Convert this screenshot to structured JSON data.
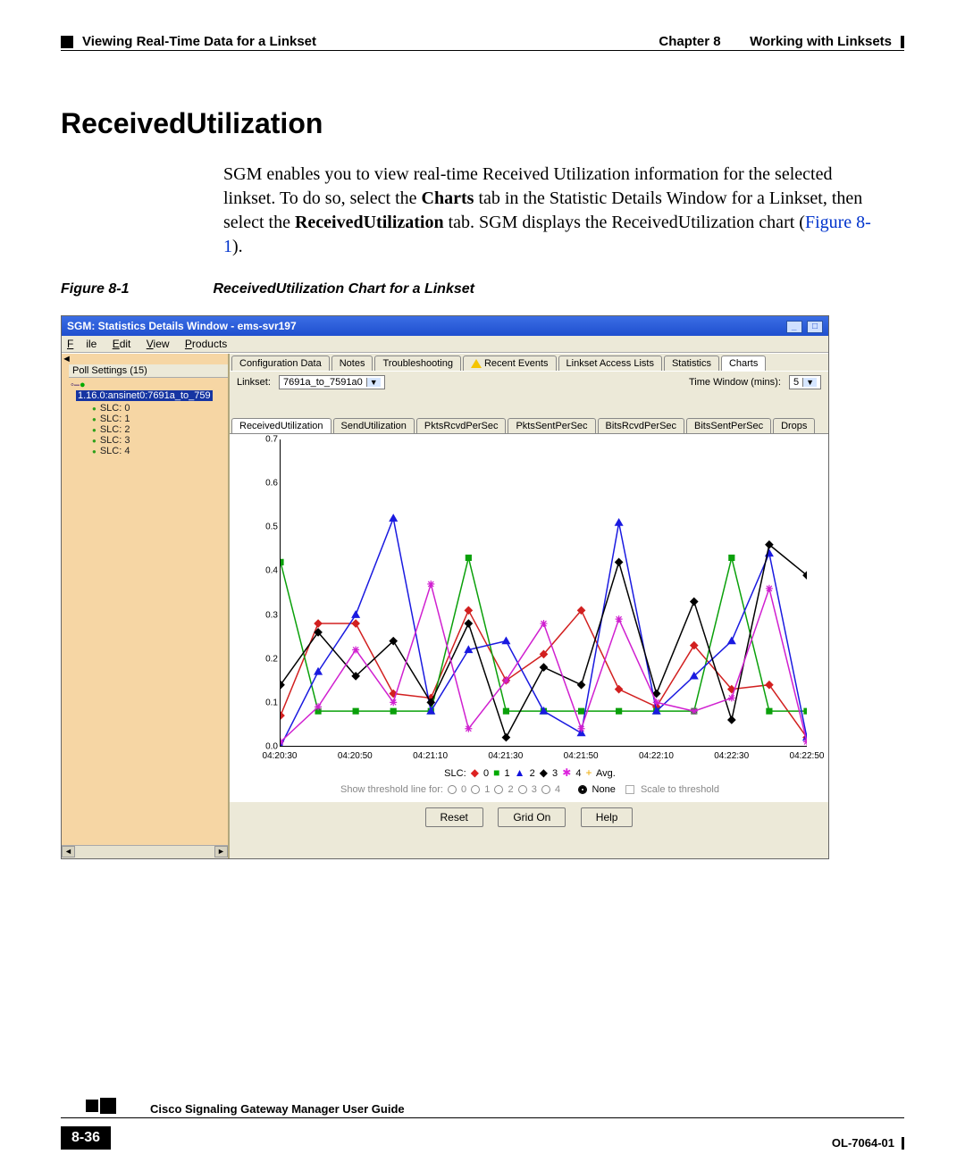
{
  "header": {
    "left": "Viewing Real-Time Data for a Linkset",
    "right_chapter": "Chapter 8",
    "right_title": "Working with Linksets"
  },
  "section_title": "ReceivedUtilization",
  "body": {
    "p1a": "SGM enables you to view real-time Received Utilization information for the selected linkset. To do so, select the ",
    "p1b": "Charts",
    "p1c": " tab in the Statistic Details Window for a Linkset, then select the ",
    "p1d": "ReceivedUtilization",
    "p1e": " tab. SGM displays the ReceivedUtilization chart (",
    "p1f": "Figure 8-1",
    "p1g": ")."
  },
  "figcap": {
    "num": "Figure 8-1",
    "txt": "ReceivedUtilization Chart for a Linkset"
  },
  "window": {
    "title": "SGM: Statistics Details Window - ems-svr197",
    "menu": {
      "file": "File",
      "edit": "Edit",
      "view": "View",
      "products": "Products"
    },
    "sidebar_head": "Poll Settings (15)",
    "sidebar_node": "1.16.0:ansinet0:7691a_to_759",
    "sidebar_items": [
      "SLC: 0",
      "SLC: 1",
      "SLC: 2",
      "SLC: 3",
      "SLC: 4"
    ],
    "tabs1": [
      "Configuration Data",
      "Notes",
      "Troubleshooting",
      "Recent Events",
      "Linkset Access Lists",
      "Statistics",
      "Charts"
    ],
    "tabs2": [
      "ReceivedUtilization",
      "SendUtilization",
      "PktsRcvdPerSec",
      "PktsSentPerSec",
      "BitsRcvdPerSec",
      "BitsSentPerSec",
      "Drops"
    ],
    "linkset_label": "Linkset:",
    "linkset_value": "7691a_to_7591a0",
    "timewin_label": "Time Window (mins):",
    "timewin_value": "5",
    "legend_label": "SLC:",
    "legend_items": [
      {
        "sym": "◆",
        "color": "#d22",
        "label": "0"
      },
      {
        "sym": "■",
        "color": "#0a0",
        "label": "1"
      },
      {
        "sym": "▲",
        "color": "#11d",
        "label": "2"
      },
      {
        "sym": "◆",
        "color": "#000",
        "label": "3"
      },
      {
        "sym": "✱",
        "color": "#d2d",
        "label": "4"
      },
      {
        "sym": "+",
        "color": "#ea0",
        "label": "Avg."
      }
    ],
    "thresh_label": "Show threshold line for:",
    "thresh_options": [
      "0",
      "1",
      "2",
      "3",
      "4"
    ],
    "thresh_none": "None",
    "thresh_scale": "Scale to threshold",
    "buttons": {
      "reset": "Reset",
      "grid": "Grid On",
      "help": "Help"
    }
  },
  "chart_data": {
    "type": "line",
    "xlabel": "",
    "ylabel": "",
    "ylim": [
      0.0,
      0.7
    ],
    "yticks": [
      0.0,
      0.1,
      0.2,
      0.3,
      0.4,
      0.5,
      0.6,
      0.7
    ],
    "x_categories": [
      "04:20:30",
      "04:20:50",
      "04:21:10",
      "04:21:30",
      "04:21:50",
      "04:22:10",
      "04:22:30",
      "04:22:50"
    ],
    "series": [
      {
        "name": "0",
        "color": "#d22020",
        "marker": "diamond",
        "values": [
          0.07,
          0.28,
          0.28,
          0.12,
          0.11,
          0.31,
          0.15,
          0.21,
          0.31,
          0.13,
          0.09,
          0.23,
          0.13,
          0.14,
          0.02
        ]
      },
      {
        "name": "1",
        "color": "#0aa00a",
        "marker": "square",
        "values": [
          0.42,
          0.08,
          0.08,
          0.08,
          0.08,
          0.43,
          0.08,
          0.08,
          0.08,
          0.08,
          0.08,
          0.08,
          0.43,
          0.08,
          0.08
        ]
      },
      {
        "name": "2",
        "color": "#1a1ae0",
        "marker": "triangle",
        "values": [
          0.0,
          0.17,
          0.3,
          0.52,
          0.08,
          0.22,
          0.24,
          0.08,
          0.03,
          0.51,
          0.08,
          0.16,
          0.24,
          0.44,
          0.02
        ]
      },
      {
        "name": "3",
        "color": "#000000",
        "marker": "diamond",
        "values": [
          0.14,
          0.26,
          0.16,
          0.24,
          0.1,
          0.28,
          0.02,
          0.18,
          0.14,
          0.42,
          0.12,
          0.33,
          0.06,
          0.46,
          0.39
        ]
      },
      {
        "name": "4",
        "color": "#d020d0",
        "marker": "star",
        "values": [
          0.01,
          0.09,
          0.22,
          0.1,
          0.37,
          0.04,
          0.15,
          0.28,
          0.04,
          0.29,
          0.1,
          0.08,
          0.11,
          0.36,
          0.01
        ]
      }
    ]
  },
  "footer": {
    "guide": "Cisco Signaling Gateway Manager User Guide",
    "page": "8-36",
    "doc": "OL-7064-01"
  }
}
